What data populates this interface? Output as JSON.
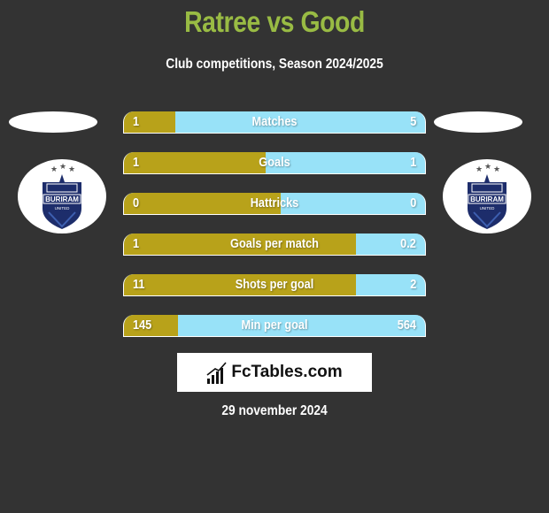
{
  "header": {
    "title": "Ratree vs Good",
    "subtitle": "Club competitions, Season 2024/2025"
  },
  "teams": {
    "left": {
      "name": "Ratree",
      "logo": "buriram-united-crest-icon",
      "crest_text": "BURIRAM",
      "crest_subtext": "UNITED"
    },
    "right": {
      "name": "Good",
      "logo": "buriram-united-crest-icon",
      "crest_text": "BURIRAM",
      "crest_subtext": "UNITED"
    }
  },
  "colors": {
    "background": "#333333",
    "title": "#99bb44",
    "left_bar": "#b8a21a",
    "right_bar": "#98e2f8"
  },
  "stats": [
    {
      "label": "Matches",
      "left": "1",
      "right": "5",
      "left_share": 0.17
    },
    {
      "label": "Goals",
      "left": "1",
      "right": "1",
      "left_share": 0.47
    },
    {
      "label": "Hattricks",
      "left": "0",
      "right": "0",
      "left_share": 0.52
    },
    {
      "label": "Goals per match",
      "left": "1",
      "right": "0.2",
      "left_share": 0.77
    },
    {
      "label": "Shots per goal",
      "left": "11",
      "right": "2",
      "left_share": 0.77
    },
    {
      "label": "Min per goal",
      "left": "145",
      "right": "564",
      "left_share": 0.18
    }
  ],
  "brand": {
    "name": "FcTables.com",
    "icon": "bar-chart-icon"
  },
  "footer": {
    "date": "29 november 2024"
  }
}
